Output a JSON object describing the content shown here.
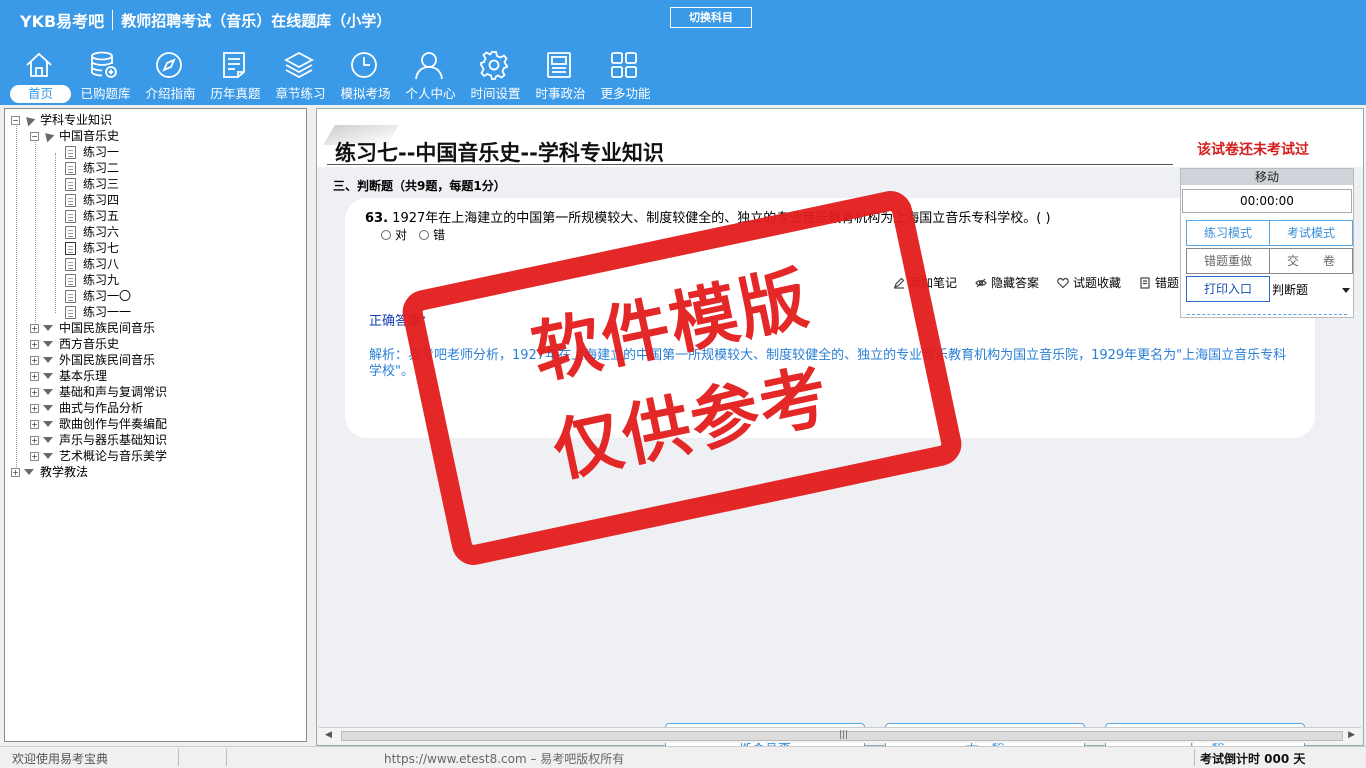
{
  "app": {
    "brand": "YKB易考吧",
    "subtitle": "教师招聘考试（音乐）在线题库（小学）",
    "switch_subject": "切换科目"
  },
  "nav": [
    {
      "label": "首页",
      "icon": "home-icon",
      "active": true
    },
    {
      "label": "已购题库",
      "icon": "database-icon"
    },
    {
      "label": "介绍指南",
      "icon": "compass-icon"
    },
    {
      "label": "历年真题",
      "icon": "list-icon"
    },
    {
      "label": "章节练习",
      "icon": "layers-icon"
    },
    {
      "label": "模拟考场",
      "icon": "clock-icon"
    },
    {
      "label": "个人中心",
      "icon": "user-icon"
    },
    {
      "label": "时间设置",
      "icon": "gear-icon"
    },
    {
      "label": "时事政治",
      "icon": "newspaper-icon"
    },
    {
      "label": "更多功能",
      "icon": "grid-icon"
    }
  ],
  "tree": {
    "root": "学科专业知识",
    "group": "中国音乐史",
    "exercises": [
      "练习一",
      "练习二",
      "练习三",
      "练习四",
      "练习五",
      "练习六",
      "练习七",
      "练习八",
      "练习九",
      "练习一〇",
      "练习一一"
    ],
    "current_index": 6,
    "other_groups": [
      "中国民族民间音乐",
      "西方音乐史",
      "外国民族民间音乐",
      "基本乐理",
      "基础和声与复调常识",
      "曲式与作品分析",
      "歌曲创作与伴奏编配",
      "声乐与器乐基础知识",
      "艺术概论与音乐美学"
    ],
    "root2": "教学教法"
  },
  "exam": {
    "title": "练习七--中国音乐史--学科专业知识",
    "status": "该试卷还未考试过",
    "section": "三、判断题（共9题，每题1分）",
    "question_number": "63.",
    "question_text": "1927年在上海建立的中国第一所规模较大、制度较健全的、独立的专业音乐教育机构为上海国立音乐专科学校。( )",
    "options": [
      "对",
      "错"
    ],
    "tools": [
      "添加笔记",
      "隐藏答案",
      "试题收藏",
      "错题"
    ],
    "answer_label": "正确答案：",
    "analysis": "解析：易考吧老师分析，1927年在上海建立的中国第一所规模较大、制度较健全的、独立的专业音乐教育机构为国立音乐院，1929年更名为\"上海国立音乐专科学校\"。"
  },
  "buttons": {
    "submit": "提交答案",
    "prev": "上一题",
    "next": "下一题"
  },
  "control": {
    "move": "移动",
    "timer": "00:00:00",
    "practice_mode": "练习模式",
    "exam_mode": "考试模式",
    "redo_wrong": "错题重做",
    "submit_paper": "交　　卷",
    "print": "打印入口",
    "type_select": "判断题"
  },
  "watermark": {
    "line1": "软件模版",
    "line2": "仅供参考"
  },
  "status": {
    "welcome": "欢迎使用易考宝典",
    "copyright": "https://www.etest8.com – 易考吧版权所有",
    "countdown": "考试倒计时 000 天"
  }
}
